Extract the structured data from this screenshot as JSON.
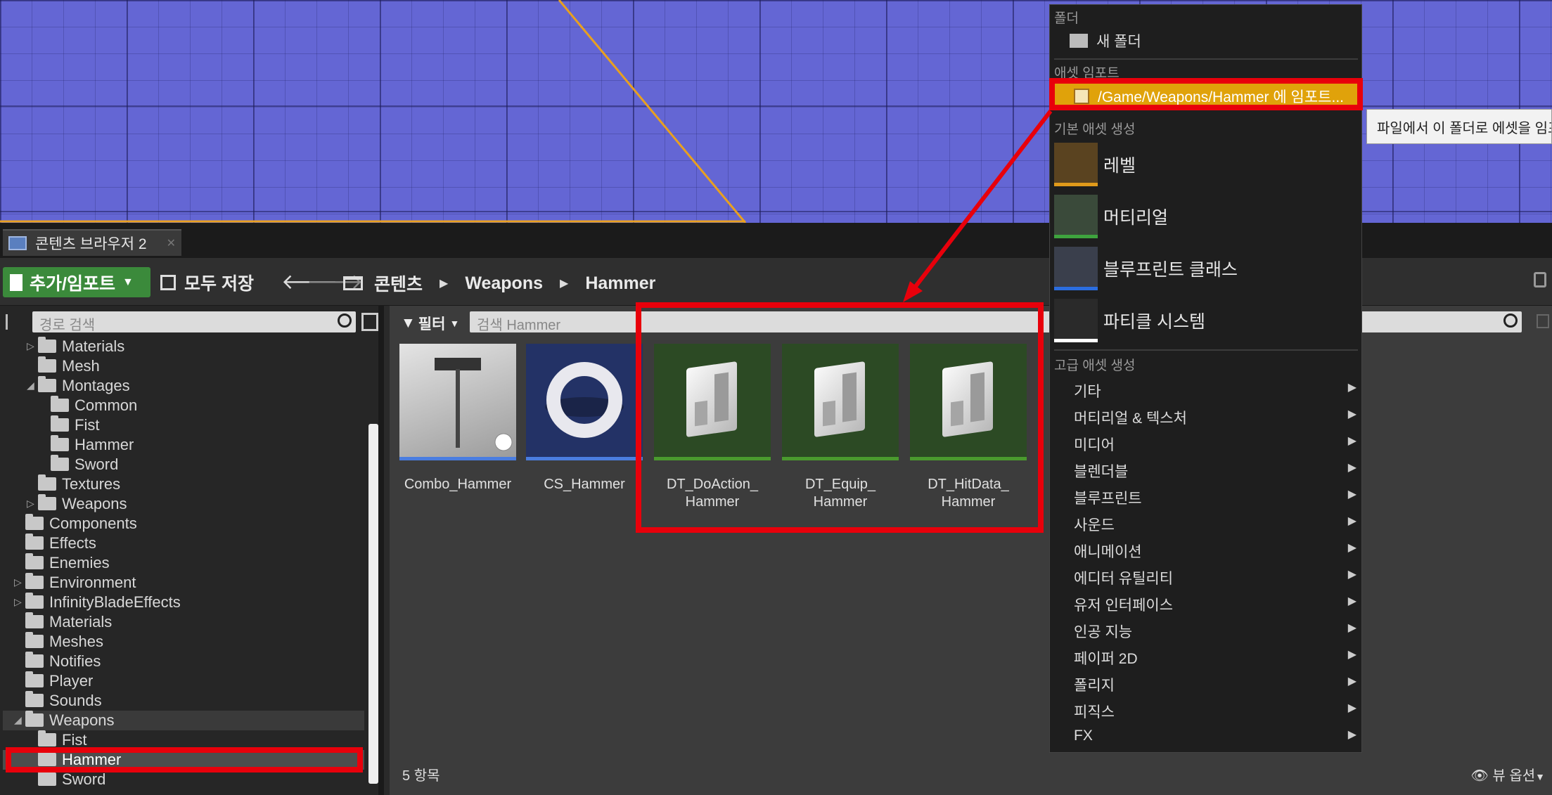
{
  "tab": {
    "title": "콘텐츠 브라우저 2"
  },
  "toolbar": {
    "add_import_label": "추가/임포트",
    "save_all_label": "모두 저장",
    "breadcrumb": [
      "콘텐츠",
      "Weapons",
      "Hammer"
    ]
  },
  "left_panel": {
    "search_placeholder": "경로 검색",
    "tree": [
      {
        "label": "Materials",
        "depth": 2,
        "expander": "collapsed"
      },
      {
        "label": "Mesh",
        "depth": 2,
        "expander": "none"
      },
      {
        "label": "Montages",
        "depth": 2,
        "expander": "expanded"
      },
      {
        "label": "Common",
        "depth": 3,
        "expander": "none"
      },
      {
        "label": "Fist",
        "depth": 3,
        "expander": "none"
      },
      {
        "label": "Hammer",
        "depth": 3,
        "expander": "none"
      },
      {
        "label": "Sword",
        "depth": 3,
        "expander": "none"
      },
      {
        "label": "Textures",
        "depth": 2,
        "expander": "none"
      },
      {
        "label": "Weapons",
        "depth": 2,
        "expander": "collapsed"
      },
      {
        "label": "Components",
        "depth": 1,
        "expander": "none"
      },
      {
        "label": "Effects",
        "depth": 1,
        "expander": "none"
      },
      {
        "label": "Enemies",
        "depth": 1,
        "expander": "none"
      },
      {
        "label": "Environment",
        "depth": 1,
        "expander": "collapsed"
      },
      {
        "label": "InfinityBladeEffects",
        "depth": 1,
        "expander": "collapsed"
      },
      {
        "label": "Materials",
        "depth": 1,
        "expander": "none"
      },
      {
        "label": "Meshes",
        "depth": 1,
        "expander": "none"
      },
      {
        "label": "Notifies",
        "depth": 1,
        "expander": "none"
      },
      {
        "label": "Player",
        "depth": 1,
        "expander": "none"
      },
      {
        "label": "Sounds",
        "depth": 1,
        "expander": "none"
      },
      {
        "label": "Weapons",
        "depth": 1,
        "expander": "expanded"
      },
      {
        "label": "Fist",
        "depth": 2,
        "expander": "none"
      },
      {
        "label": "Hammer",
        "depth": 2,
        "expander": "none",
        "selected": true
      },
      {
        "label": "Sword",
        "depth": 2,
        "expander": "none"
      }
    ]
  },
  "asset_panel": {
    "filter_label": "필터",
    "search_placeholder": "검색 Hammer",
    "assets": [
      {
        "name": "Combo_Hammer",
        "kind": "montage",
        "bar_color": "#4a7de0"
      },
      {
        "name": "CS_Hammer",
        "kind": "camera-shake",
        "bar_color": "#4a7de0"
      },
      {
        "name": "DT_DoAction_Hammer",
        "line1": "DT_DoAction_",
        "line2": "Hammer",
        "kind": "datatable",
        "bar_color": "#4a9a2e"
      },
      {
        "name": "DT_Equip_Hammer",
        "line1": "DT_Equip_",
        "line2": "Hammer",
        "kind": "datatable",
        "bar_color": "#4a9a2e"
      },
      {
        "name": "DT_HitData_Hammer",
        "line1": "DT_HitData_",
        "line2": "Hammer",
        "kind": "datatable",
        "bar_color": "#4a9a2e"
      }
    ],
    "item_count": "5 항목",
    "view_options": "뷰 옵션"
  },
  "context_menu": {
    "header_folder": "폴더",
    "new_folder": "새 폴더",
    "header_import": "애셋 임포트",
    "import_item": "/Game/Weapons/Hammer 에 임포트...",
    "header_basic": "기본 애셋 생성",
    "basic_items": [
      {
        "label": "레벨",
        "icon": "level-icon",
        "color": "#e09a1a"
      },
      {
        "label": "머티리얼",
        "icon": "material-icon",
        "color": "#3ea33e"
      },
      {
        "label": "블루프린트 클래스",
        "icon": "blueprint-icon",
        "color": "#2b6de0"
      },
      {
        "label": "파티클 시스템",
        "icon": "particle-icon",
        "color": "#ffffff"
      }
    ],
    "header_advanced": "고급 애셋 생성",
    "advanced_items": [
      "기타",
      "머티리얼 & 텍스처",
      "미디어",
      "블렌더블",
      "블루프린트",
      "사운드",
      "애니메이션",
      "에디터 유틸리티",
      "유저 인터페이스",
      "인공 지능",
      "페이퍼 2D",
      "폴리지",
      "피직스",
      "FX"
    ]
  },
  "tooltip": {
    "text": "파일에서 이 폴더로 에셋을 임포트합니다"
  },
  "colors": {
    "highlight": "#e8000b",
    "menu_highlight": "#e0a20a",
    "add_button": "#3b8a3b"
  }
}
